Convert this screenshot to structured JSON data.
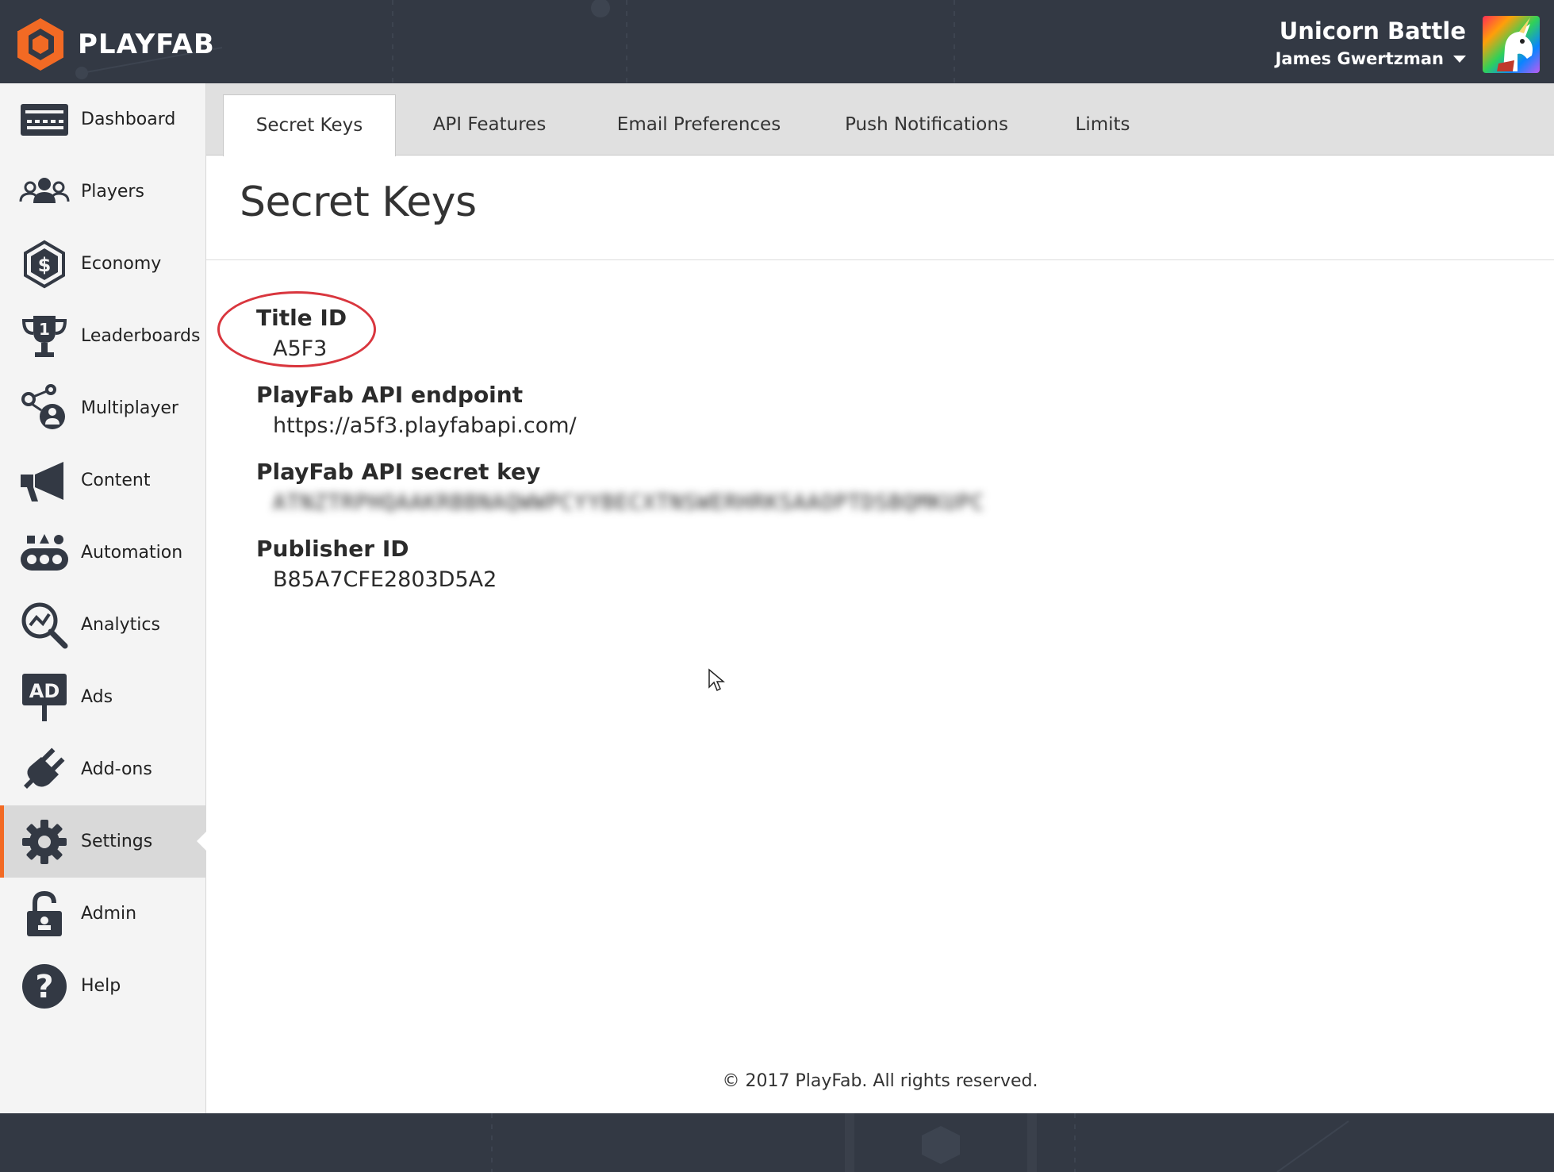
{
  "header": {
    "logo_text": "PLAYFAB",
    "game_title": "Unicorn Battle",
    "user_name": "James Gwertzman",
    "brand_color": "#f26a24",
    "background_color": "#333944"
  },
  "sidebar": {
    "items": [
      {
        "label": "Dashboard",
        "icon": "dashboard-icon"
      },
      {
        "label": "Players",
        "icon": "players-icon"
      },
      {
        "label": "Economy",
        "icon": "economy-icon"
      },
      {
        "label": "Leaderboards",
        "icon": "trophy-icon"
      },
      {
        "label": "Multiplayer",
        "icon": "multiplayer-icon"
      },
      {
        "label": "Content",
        "icon": "megaphone-icon"
      },
      {
        "label": "Automation",
        "icon": "automation-icon"
      },
      {
        "label": "Analytics",
        "icon": "analytics-icon"
      },
      {
        "label": "Ads",
        "icon": "ads-icon"
      },
      {
        "label": "Add-ons",
        "icon": "plug-icon"
      },
      {
        "label": "Settings",
        "icon": "gear-icon",
        "active": true
      },
      {
        "label": "Admin",
        "icon": "lock-icon"
      },
      {
        "label": "Help",
        "icon": "help-icon"
      }
    ]
  },
  "tabs": [
    {
      "label": "Secret Keys",
      "active": true
    },
    {
      "label": "API Features"
    },
    {
      "label": "Email Preferences"
    },
    {
      "label": "Push Notifications"
    },
    {
      "label": "Limits"
    }
  ],
  "main": {
    "page_title": "Secret Keys",
    "fields": [
      {
        "label": "Title ID",
        "value": "A5F3",
        "highlighted": true
      },
      {
        "label": "PlayFab API endpoint",
        "value": "https://a5f3.playfabapi.com/"
      },
      {
        "label": "PlayFab API secret key",
        "value": "ATNZTRPHQAAKRBBNAQWWPCYYBECXTNSWERHRKSAAOPTDSBQMKUPC",
        "blurred": true
      },
      {
        "label": "Publisher ID",
        "value": "B85A7CFE2803D5A2"
      }
    ],
    "highlight_color": "#d9363e"
  },
  "footer": {
    "copyright": "© 2017 PlayFab. All rights reserved."
  }
}
